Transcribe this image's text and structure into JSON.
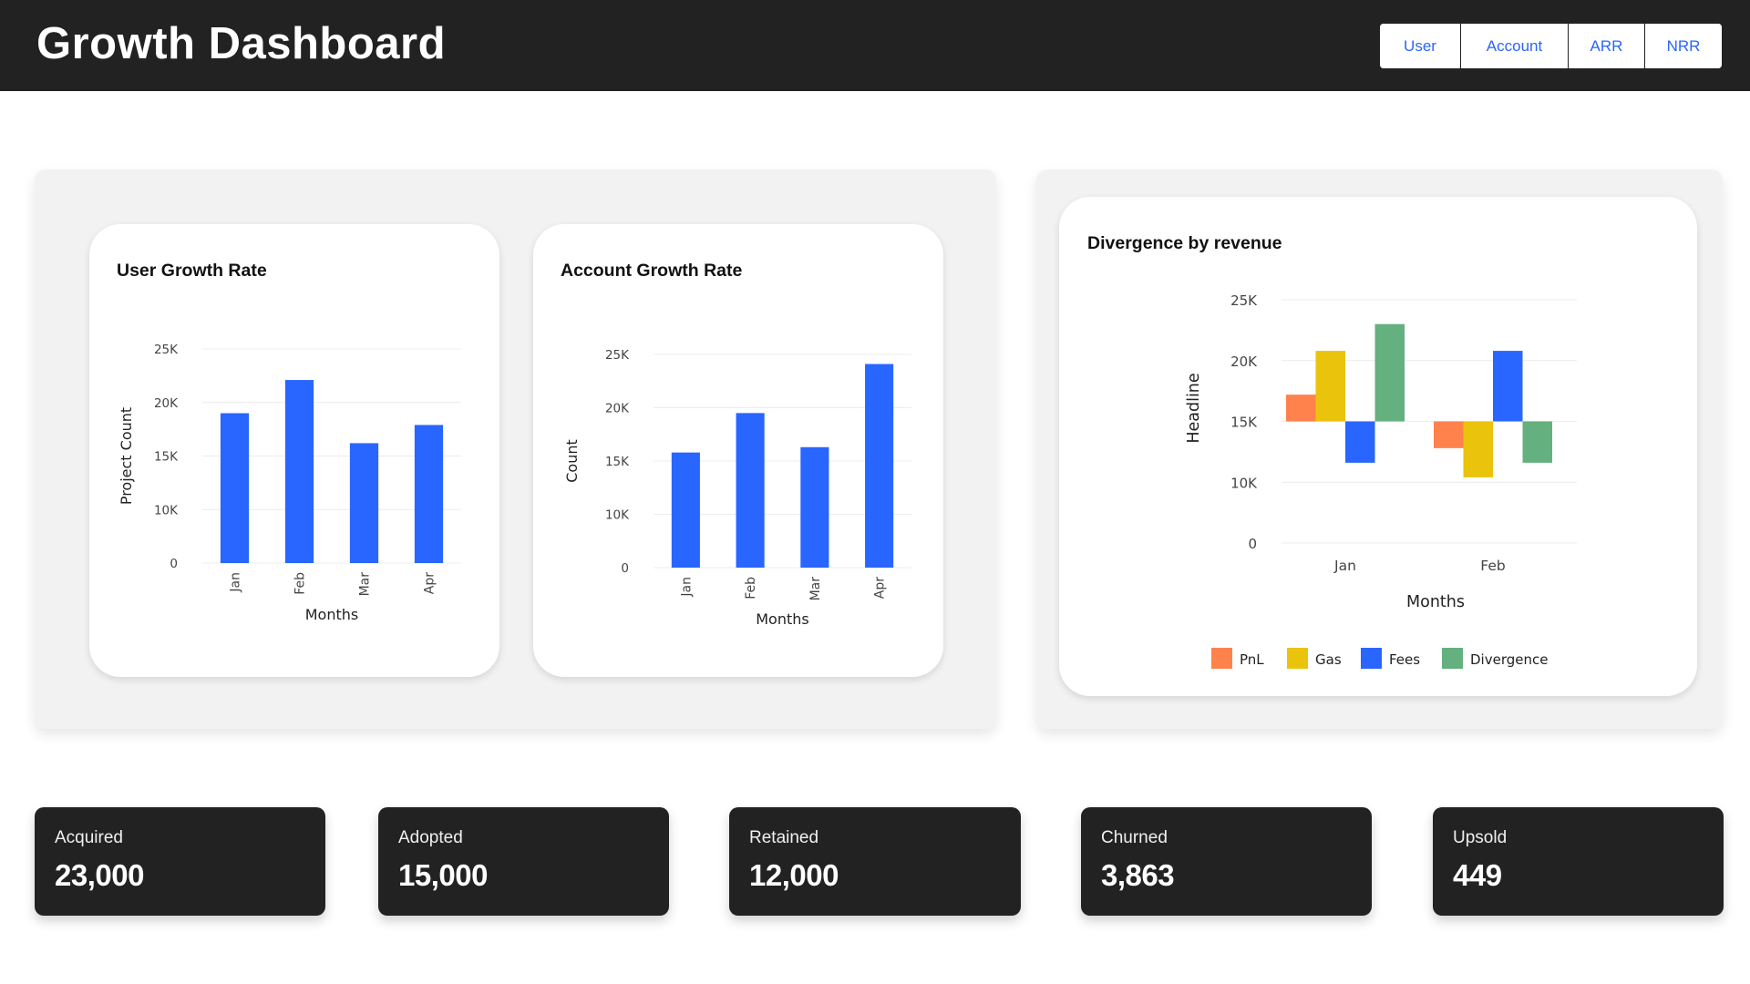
{
  "header": {
    "title": "Growth Dashboard",
    "nav": [
      {
        "label": "User"
      },
      {
        "label": "Account"
      },
      {
        "label": "ARR"
      },
      {
        "label": "NRR"
      }
    ]
  },
  "colors": {
    "header_bg": "#222222",
    "nav_text": "#2a66f5",
    "bar_blue": "#2966ff",
    "pnl": "#ff824d",
    "gas": "#eac30c",
    "fees": "#2966ff",
    "divergence": "#64b07e",
    "stat_bg": "#222222",
    "panel_bg": "#f2f2f2"
  },
  "chart_data": [
    {
      "id": "user-growth",
      "type": "bar",
      "title": "User Growth Rate",
      "xlabel": "Months",
      "ylabel": "Project Count",
      "categories": [
        "Jan",
        "Feb",
        "Mar",
        "Apr"
      ],
      "values": [
        19000,
        22100,
        16200,
        17900
      ],
      "ytick_labels": [
        "0",
        "10K",
        "15K",
        "20K",
        "25K"
      ],
      "ylim": [
        0,
        25000
      ],
      "grid": true,
      "x_tick_rotation": "vertical"
    },
    {
      "id": "account-growth",
      "type": "bar",
      "title": "Account Growth Rate",
      "xlabel": "Months",
      "ylabel": "Count",
      "categories": [
        "Jan",
        "Feb",
        "Mar",
        "Apr"
      ],
      "values": [
        15800,
        19500,
        16300,
        24100
      ],
      "ytick_labels": [
        "0",
        "10K",
        "15K",
        "20K",
        "25K"
      ],
      "ylim": [
        0,
        25000
      ],
      "grid": true,
      "x_tick_rotation": "vertical"
    },
    {
      "id": "divergence",
      "type": "bar",
      "title": "Divergence by revenue",
      "xlabel": "Months",
      "ylabel": "Headline",
      "categories": [
        "Jan",
        "Feb"
      ],
      "baseline": 15000,
      "series": [
        {
          "name": "PnL",
          "values": [
            17200,
            12800
          ]
        },
        {
          "name": "Gas",
          "values": [
            20800,
            10400
          ]
        },
        {
          "name": "Fees",
          "values": [
            11600,
            20800
          ]
        },
        {
          "name": "Divergence",
          "values": [
            23000,
            11600
          ]
        }
      ],
      "ytick_labels": [
        "0",
        "10K",
        "15K",
        "20K",
        "25K"
      ],
      "ylim": [
        0,
        25000
      ],
      "grid": true,
      "legend": "bottom"
    }
  ],
  "stats": [
    {
      "label": "Acquired",
      "value": "23,000"
    },
    {
      "label": "Adopted",
      "value": "15,000"
    },
    {
      "label": "Retained",
      "value": "12,000"
    },
    {
      "label": "Churned",
      "value": "3,863"
    },
    {
      "label": "Upsold",
      "value": "449"
    }
  ]
}
